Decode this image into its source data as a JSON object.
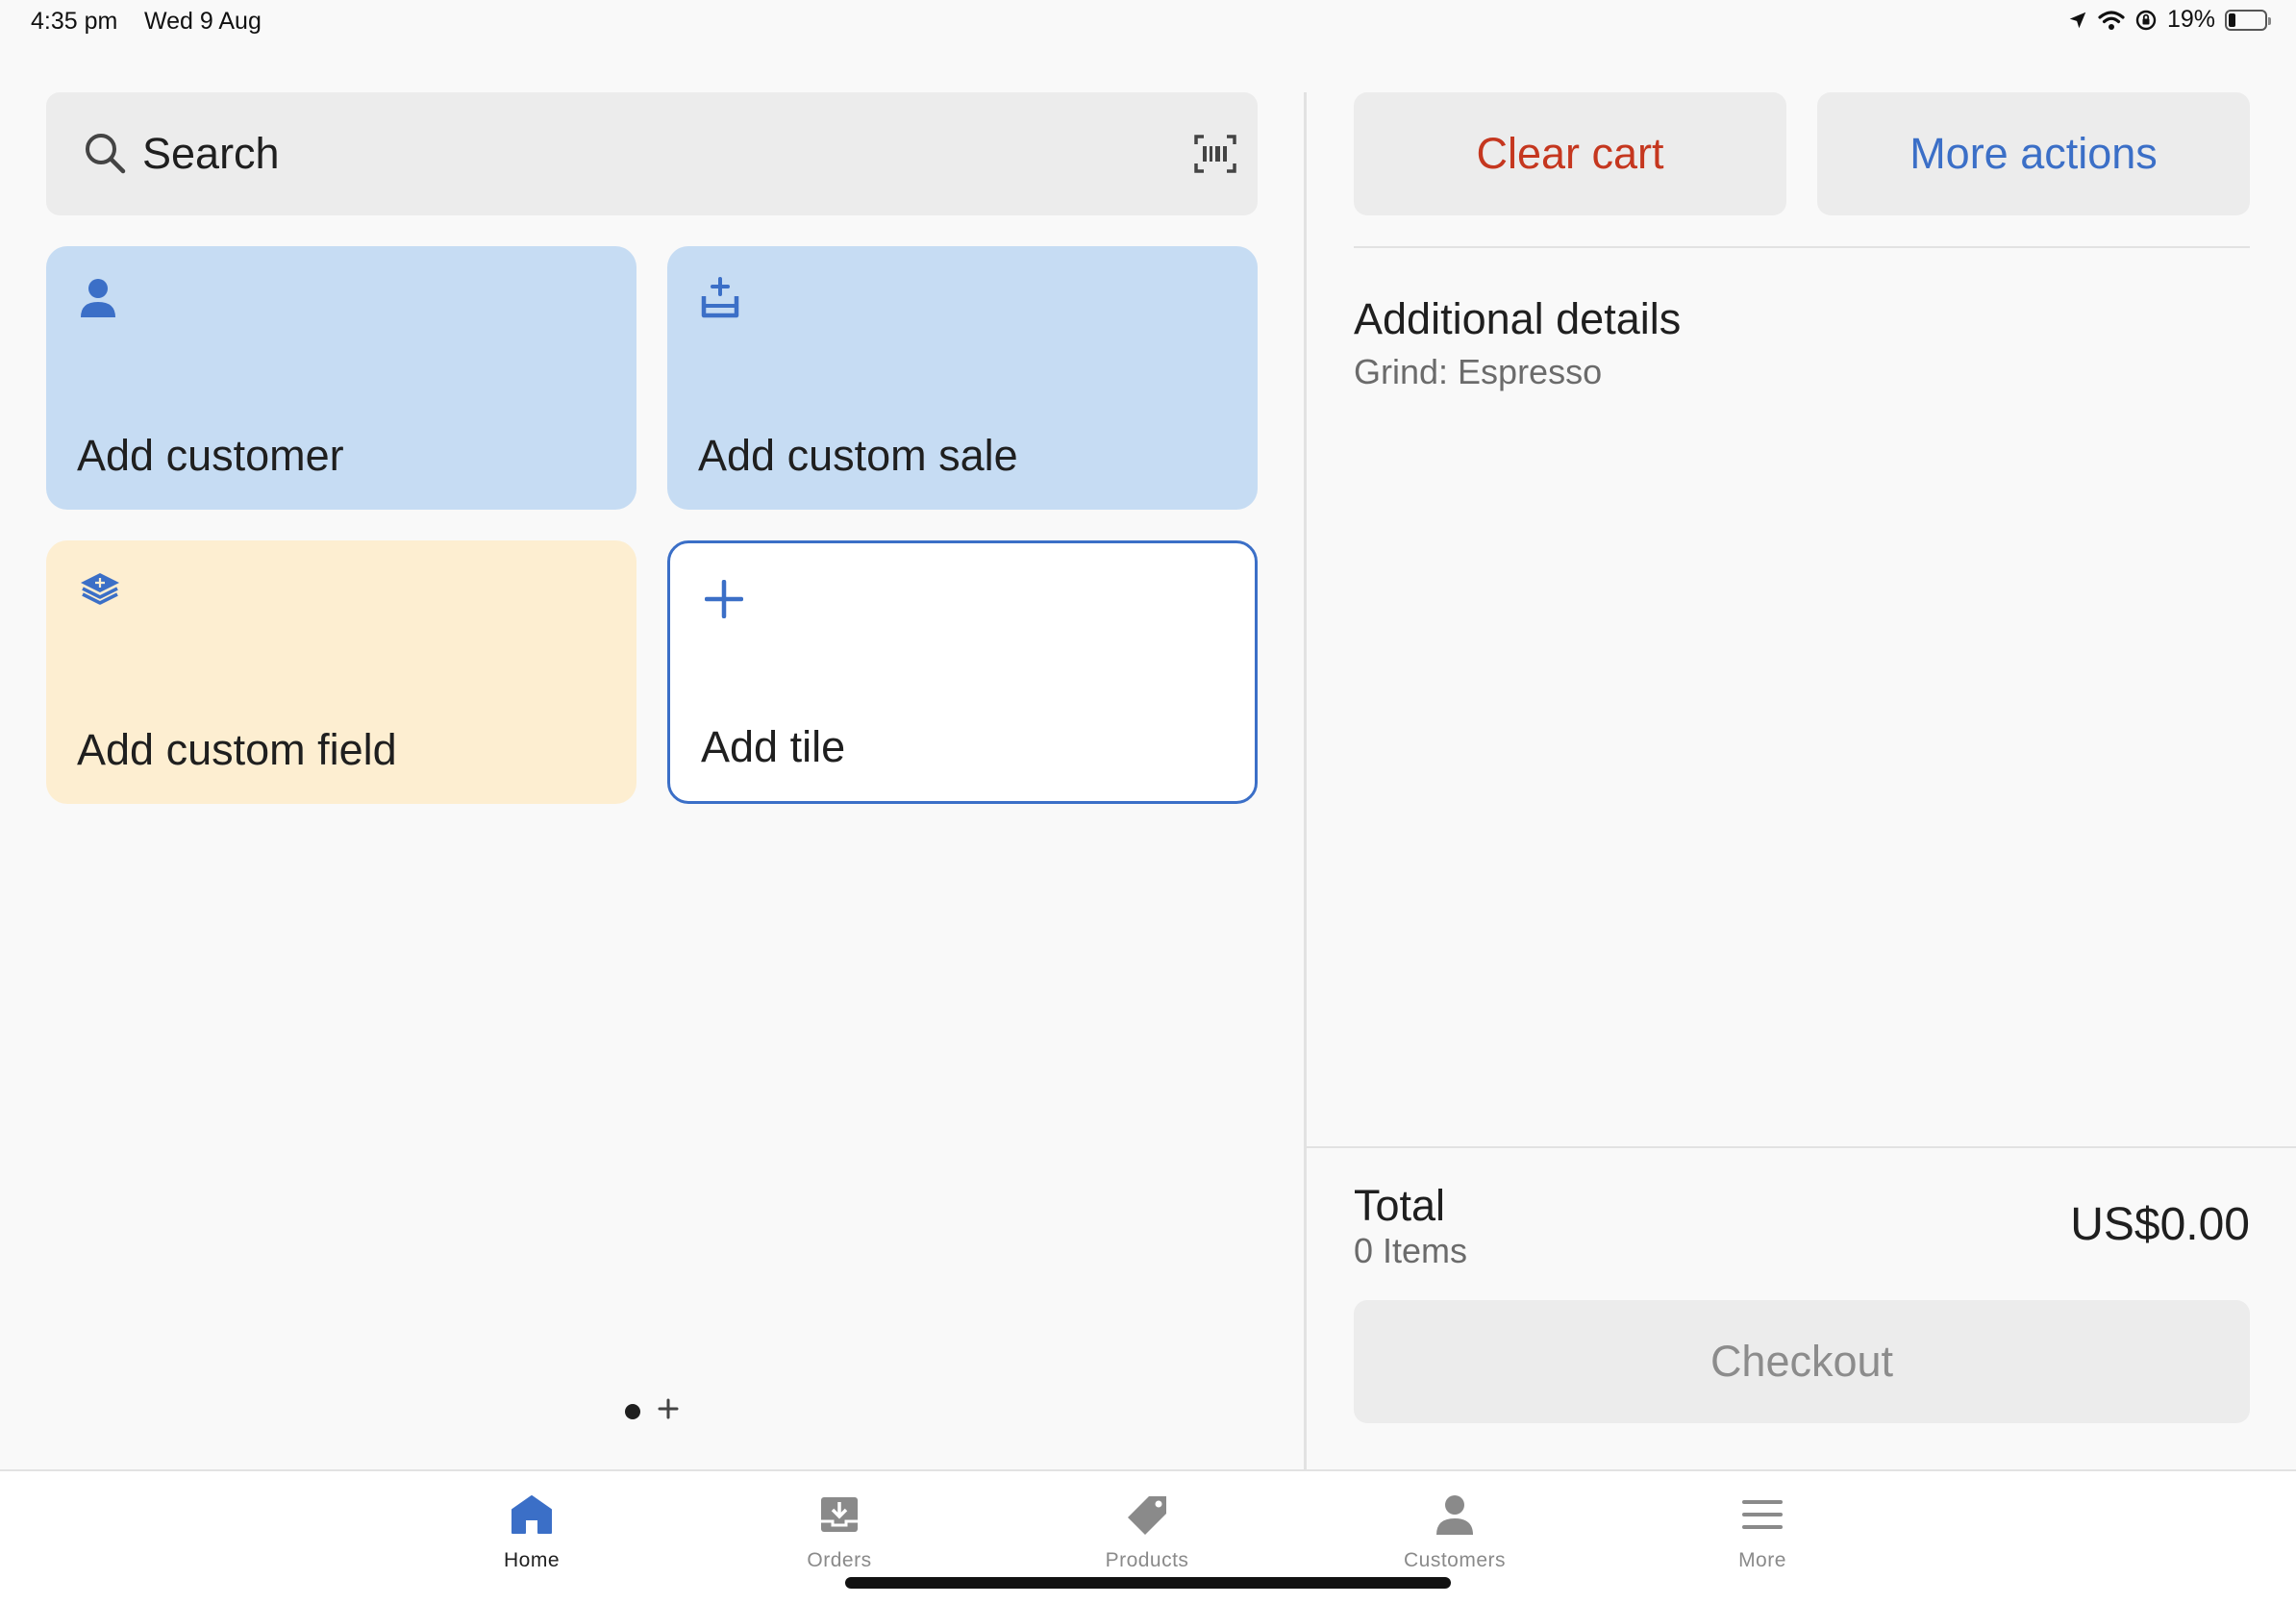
{
  "status_bar": {
    "time": "4:35 pm",
    "date": "Wed 9 Aug",
    "battery": "19%"
  },
  "search": {
    "placeholder": "Search"
  },
  "tiles": [
    {
      "label": "Add customer",
      "icon": "person-icon"
    },
    {
      "label": "Add custom sale",
      "icon": "basket-plus-icon"
    },
    {
      "label": "Add custom field",
      "icon": "layers-icon"
    },
    {
      "label": "Add tile",
      "icon": "plus-icon"
    }
  ],
  "cart": {
    "clear_label": "Clear cart",
    "more_actions_label": "More actions",
    "details_title": "Additional details",
    "details_line": "Grind: Espresso",
    "total_label": "Total",
    "items_label": "0 Items",
    "total_amount": "US$0.00",
    "checkout_label": "Checkout"
  },
  "tabs": [
    {
      "label": "Home",
      "active": true
    },
    {
      "label": "Orders",
      "active": false
    },
    {
      "label": "Products",
      "active": false
    },
    {
      "label": "Customers",
      "active": false
    },
    {
      "label": "More",
      "active": false
    }
  ],
  "colors": {
    "accent": "#3b6fc7",
    "danger": "#c5371f",
    "tile_blue": "#c6dcf3",
    "tile_yellow": "#fdeed1"
  }
}
